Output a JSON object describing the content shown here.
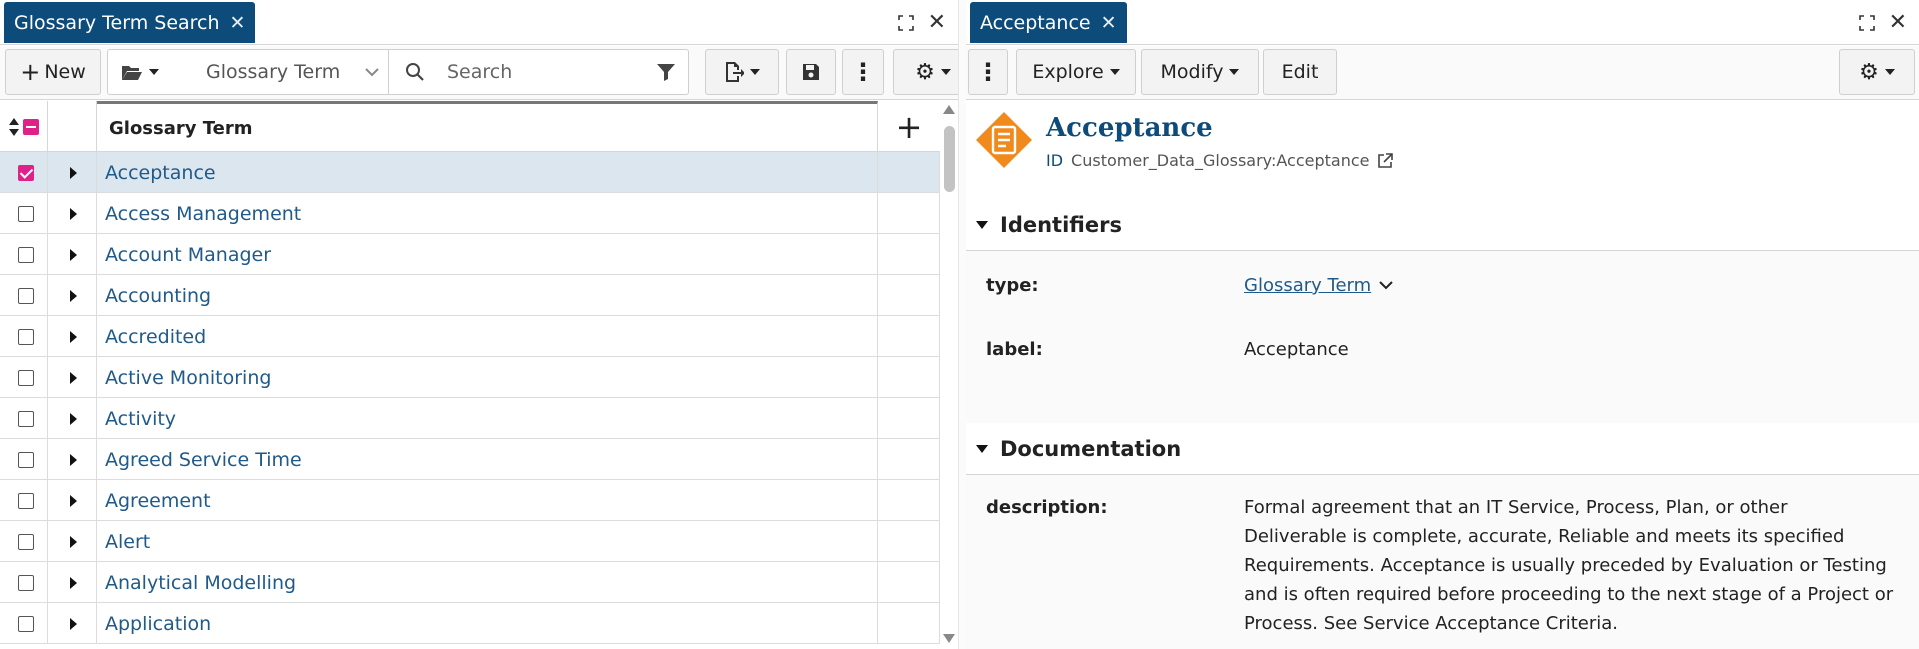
{
  "left_pane": {
    "tab_label": "Glossary Term Search",
    "toolbar": {
      "new_label": "New",
      "type_value": "Glossary Term",
      "search_placeholder": "Search"
    },
    "grid": {
      "column_header": "Glossary Term",
      "rows": [
        {
          "label": "Acceptance",
          "checked": true
        },
        {
          "label": "Access Management",
          "checked": false
        },
        {
          "label": "Account Manager",
          "checked": false
        },
        {
          "label": "Accounting",
          "checked": false
        },
        {
          "label": "Accredited",
          "checked": false
        },
        {
          "label": "Active Monitoring",
          "checked": false
        },
        {
          "label": "Activity",
          "checked": false
        },
        {
          "label": "Agreed Service Time",
          "checked": false
        },
        {
          "label": "Agreement",
          "checked": false
        },
        {
          "label": "Alert",
          "checked": false
        },
        {
          "label": "Analytical Modelling",
          "checked": false
        },
        {
          "label": "Application",
          "checked": false
        }
      ]
    }
  },
  "right_pane": {
    "tab_label": "Acceptance",
    "toolbar": {
      "explore_label": "Explore",
      "modify_label": "Modify",
      "edit_label": "Edit"
    },
    "object": {
      "title": "Acceptance",
      "id_label": "ID",
      "id_value": "Customer_Data_Glossary:Acceptance"
    },
    "sections": {
      "identifiers": {
        "title": "Identifiers",
        "type_label": "type:",
        "type_value": "Glossary Term",
        "label_label": "label:",
        "label_value": "Acceptance"
      },
      "documentation": {
        "title": "Documentation",
        "description_label": "description:",
        "description_value": "Formal agreement that an IT Service, Process, Plan, or other Deliverable is complete, accurate, Reliable and meets its specified Requirements. Acceptance is usually preceded by Evaluation or Testing and is often required before proceeding to the next stage of a Project or Process. See Service Acceptance Criteria."
      }
    }
  },
  "colors": {
    "tab_bg": "#0d4b7a",
    "link": "#1f5a8a",
    "checkbox_accent": "#e0218a",
    "selected_row": "#dce6ef",
    "object_icon": "#f08a1c"
  }
}
